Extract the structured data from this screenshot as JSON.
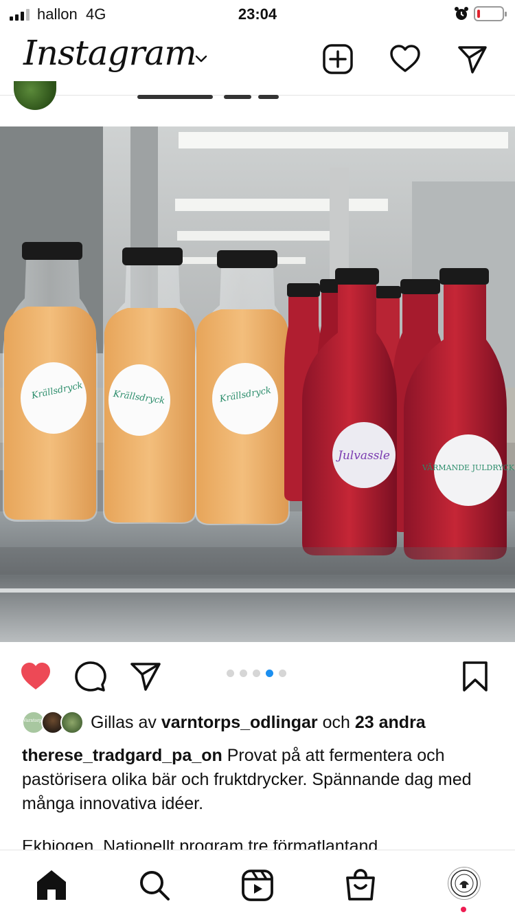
{
  "status_bar": {
    "carrier": "hallon",
    "network": "4G",
    "time": "23:04",
    "battery_level": 0.1,
    "battery_color": "#e0232f"
  },
  "header": {
    "logo": "Instagram",
    "icons": [
      "chevron-down-icon",
      "new-post-icon",
      "heart-icon",
      "direct-message-icon"
    ]
  },
  "post": {
    "photo_bottle_labels": {
      "orange": [
        "Krällsdryck",
        "Krällsdryck",
        "Krällsdryck"
      ],
      "red_front": "Julvassle",
      "red_right": "VÄRMANDE JULDRYCK"
    },
    "carousel": {
      "count": 5,
      "active_index": 3,
      "active_color": "#1c8ff0"
    },
    "liked": true,
    "like_color": "#ed4956",
    "likes": {
      "avatar_text": "Varntorps odlingar",
      "prefix": "Gillas av",
      "user": "varntorps_odlingar",
      "connector": "och",
      "others": "23 andra"
    },
    "caption": {
      "username": "therese_tradgard_pa_on",
      "text": "Provat på att fermentera och pastörisera olika bär och fruktdrycker. Spännande dag med många innovativa idéer.",
      "next_line": "Ekbiogen. Nationellt program tre förmatlantand"
    }
  },
  "bottom_nav": {
    "items": [
      "home-icon",
      "search-icon",
      "reels-icon",
      "shop-icon",
      "profile-avatar"
    ],
    "notification_color": "#ee1d52"
  }
}
